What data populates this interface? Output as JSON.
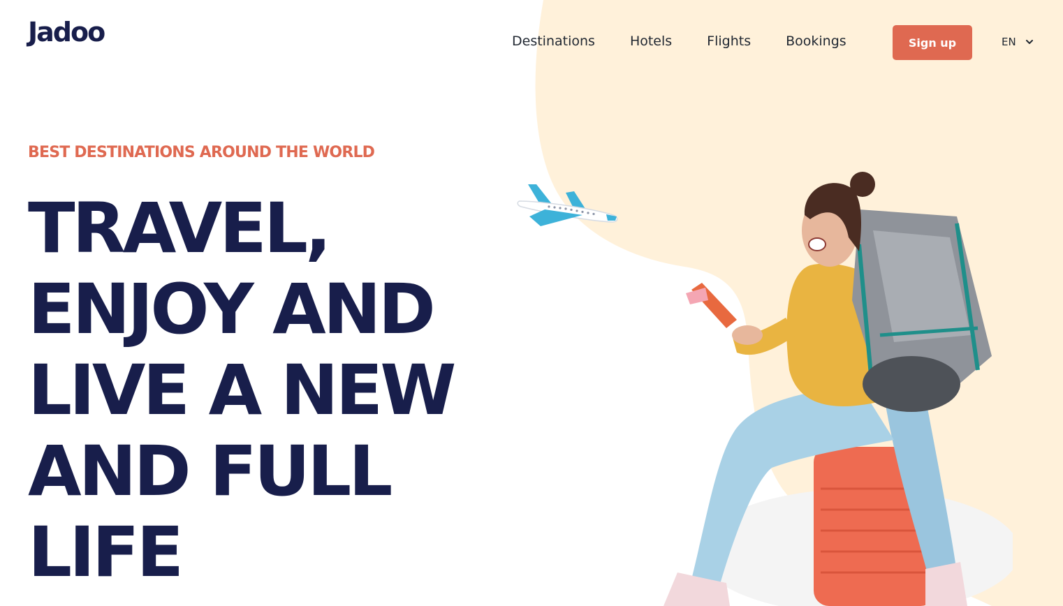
{
  "brand": {
    "name": "Jadoo",
    "accent": "#DF6951",
    "navy": "#181E4B",
    "blob": "#FFF1DA"
  },
  "nav": {
    "items": [
      "Destinations",
      "Hotels",
      "Flights",
      "Bookings"
    ],
    "signup_label": "Sign up",
    "language": "EN",
    "language_icon": "chevron-down-icon"
  },
  "hero": {
    "eyebrow": "BEST DESTINATIONS AROUND THE WORLD",
    "headline_lines": [
      "TRAVEL,",
      "ENJOY AND",
      "LIVE A NEW",
      "AND FULL",
      "LIFE"
    ]
  },
  "illustrations": {
    "plane": "airplane-icon",
    "person": "traveler-with-backpack-image"
  }
}
